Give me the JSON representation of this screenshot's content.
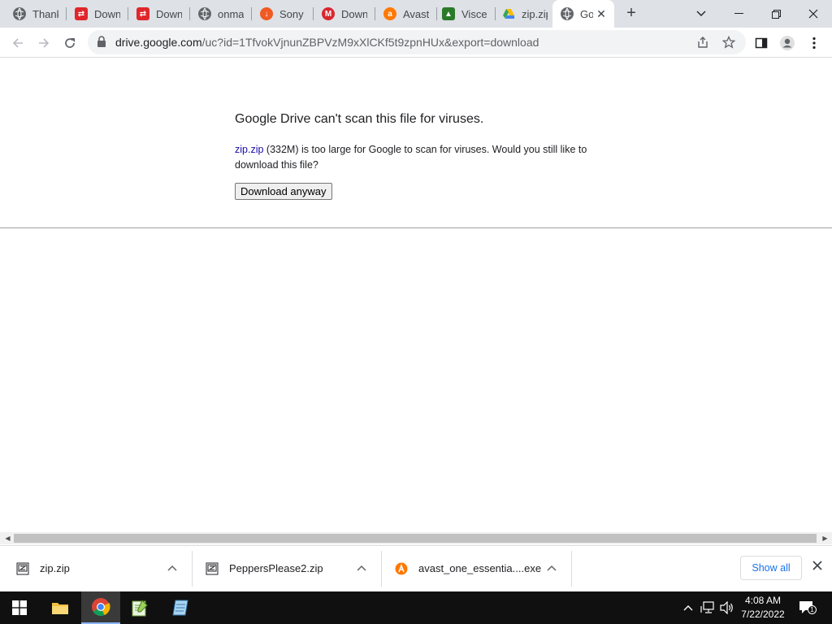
{
  "browser": {
    "tabs": [
      {
        "title": "Thank",
        "icon": "globe-icon"
      },
      {
        "title": "Downl",
        "icon": "red-download-icon"
      },
      {
        "title": "Downl",
        "icon": "red-download-icon"
      },
      {
        "title": "onmar",
        "icon": "globe-icon"
      },
      {
        "title": "Sony V",
        "icon": "orange-download-icon"
      },
      {
        "title": "Downl",
        "icon": "mega-icon"
      },
      {
        "title": "Avast",
        "icon": "avast-icon"
      },
      {
        "title": "Viscer",
        "icon": "green-game-icon"
      },
      {
        "title": "zip.zip",
        "icon": "google-drive-icon"
      },
      {
        "title": "Go",
        "icon": "globe-icon",
        "active": true
      }
    ],
    "new_tab_label": "+",
    "address_bar": {
      "host": "drive.google.com",
      "path": "/uc?id=1TfvokVjnunZBPVzM9xXlCKf5t9zpnHUx&export=download"
    }
  },
  "page": {
    "title": "Google Drive can't scan this file for viruses.",
    "file_link": "zip.zip",
    "body_text": " (332M) is too large for Google to scan for viruses. Would you still like to download this file?",
    "download_button": "Download anyway"
  },
  "downloads": {
    "items": [
      {
        "name": "zip.zip",
        "icon": "zip-archive-icon"
      },
      {
        "name": "PeppersPlease2.zip",
        "icon": "zip-archive-icon"
      },
      {
        "name": "avast_one_essentia....exe",
        "icon": "avast-icon"
      }
    ],
    "show_all": "Show all"
  },
  "taskbar": {
    "time": "4:08 AM",
    "date": "7/22/2022",
    "notification_count": "1"
  },
  "colors": {
    "accent": "#1a73e8",
    "link": "#1a0dab",
    "tabstrip": "#dee1e6",
    "taskbar": "#101010"
  }
}
